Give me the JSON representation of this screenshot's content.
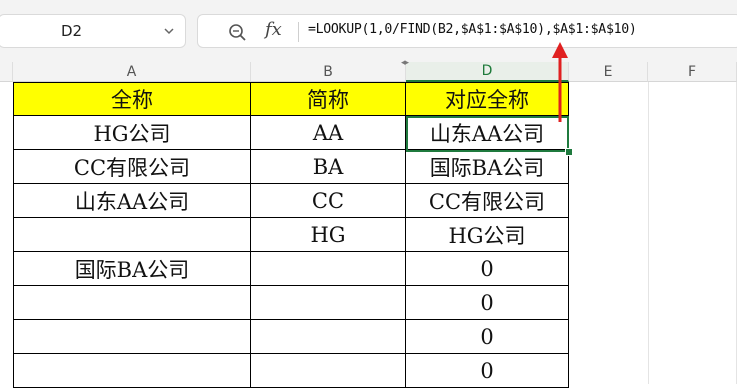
{
  "name_box": {
    "ref": "D2"
  },
  "formula_bar": {
    "fx_label": "fx",
    "formula": "=LOOKUP(1,0/FIND(B2,$A$1:$A$10),$A$1:$A$10)"
  },
  "columns": [
    "A",
    "B",
    "D",
    "E",
    "F"
  ],
  "headers": {
    "A": "全称",
    "B": "简称",
    "D": "对应全称"
  },
  "rows": [
    {
      "A": "HG公司",
      "B": "AA",
      "D": "山东AA公司"
    },
    {
      "A": "CC有限公司",
      "B": "BA",
      "D": "国际BA公司"
    },
    {
      "A": "山东AA公司",
      "B": "CC",
      "D": "CC有限公司"
    },
    {
      "A": "",
      "B": "HG",
      "D": "HG公司"
    },
    {
      "A": "国际BA公司",
      "B": "",
      "D": "0"
    },
    {
      "A": "",
      "B": "",
      "D": "0"
    },
    {
      "A": "",
      "B": "",
      "D": "0"
    },
    {
      "A": "",
      "B": "",
      "D": "0"
    }
  ],
  "colors": {
    "header_fill": "#ffff00",
    "selection": "#1f7a3e",
    "arrow": "#e02020"
  },
  "icons": [
    "chevron-down-icon",
    "zoom-icon",
    "up-arrow-annotation"
  ]
}
